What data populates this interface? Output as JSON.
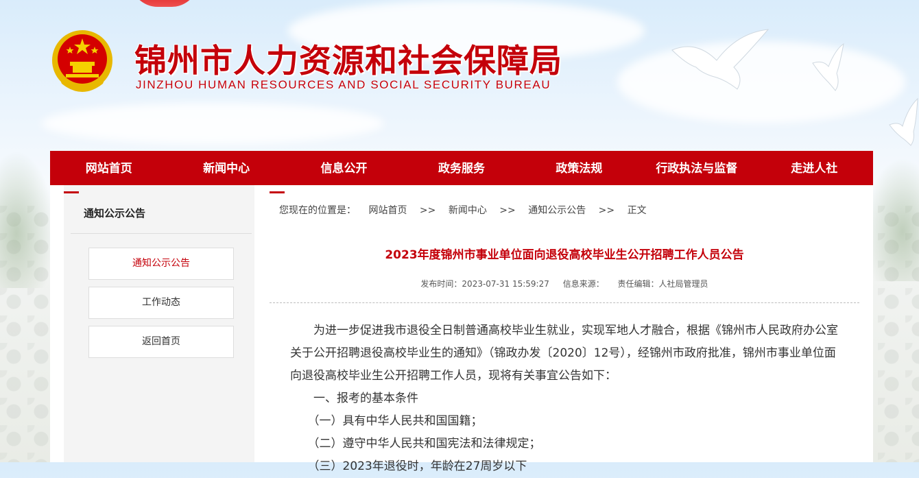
{
  "header": {
    "title": "锦州市人力资源和社会保障局",
    "subtitle": "JINZHOU HUMAN RESOURCES AND SOCIAL SECURITY BUREAU"
  },
  "nav": {
    "items": [
      "网站首页",
      "新闻中心",
      "信息公开",
      "政务服务",
      "政策法规",
      "行政执法与监督",
      "走进人社"
    ]
  },
  "sidebar": {
    "title": "通知公示公告",
    "items": [
      "通知公示公告",
      "工作动态",
      "返回首页"
    ]
  },
  "breadcrumb": {
    "prefix": "您现在的位置是：",
    "home": "网站首页",
    "news": "新闻中心",
    "section": "通知公示公告",
    "current": "正文",
    "sep": ">>"
  },
  "article": {
    "title": "2023年度锦州市事业单位面向退役高校毕业生公开招聘工作人员公告",
    "publish_time": "发布时间：2023-07-31 15:59:27",
    "source": "信息来源：",
    "editor": "责任编辑：人社局管理员",
    "paragraphs": [
      "为进一步促进我市退役全日制普通高校毕业生就业，实现军地人才融合，根据《锦州市人民政府办公室关于公开招聘退役高校毕业生的通知》（锦政办发〔2020〕12号），经锦州市政府批准，锦州市事业单位面向退役高校毕业生公开招聘工作人员，现将有关事宜公告如下：",
      "一、报考的基本条件",
      "（一）具有中华人民共和国国籍；",
      "（二）遵守中华人民共和国宪法和法律规定；",
      "（三）2023年退役时，年龄在27周岁以下"
    ]
  },
  "colors": {
    "brand_red": "#c4000a"
  }
}
